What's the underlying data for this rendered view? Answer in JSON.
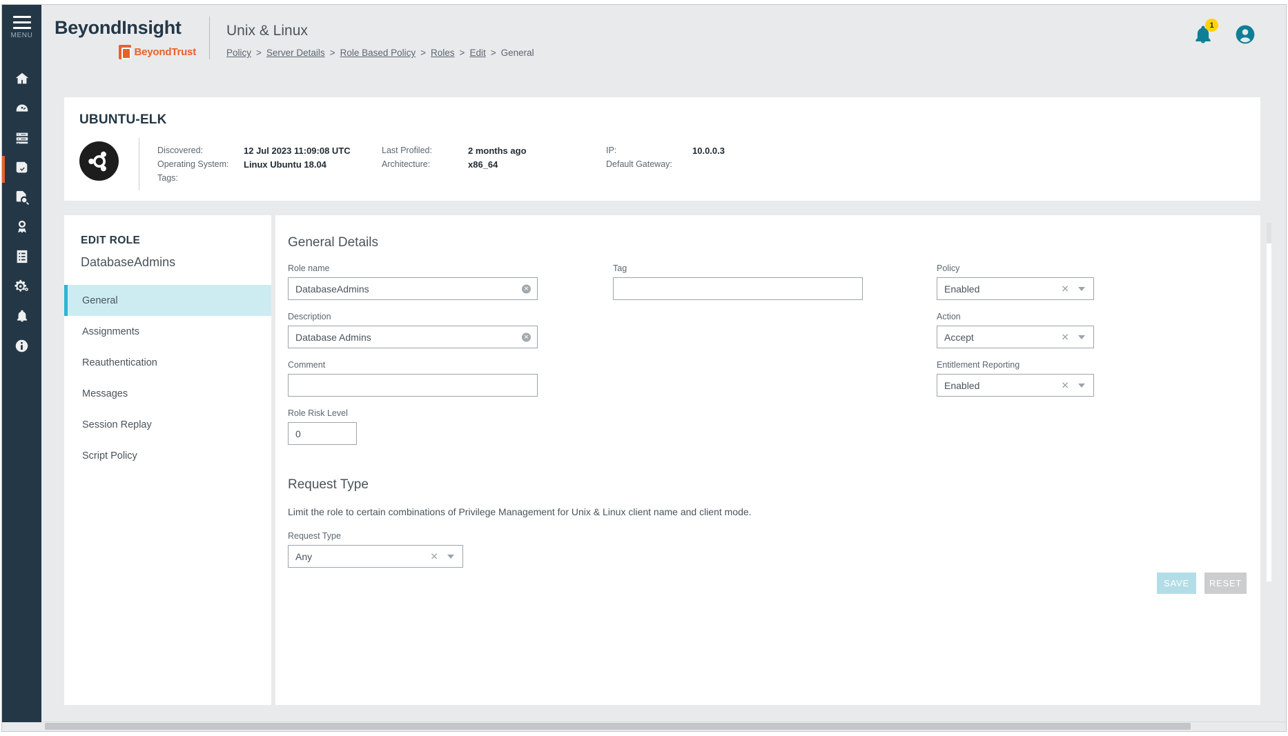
{
  "brand": {
    "product": "BeyondInsight",
    "company": "BeyondTrust",
    "logo_icon": "beyondtrust-logo-icon"
  },
  "header": {
    "page_title": "Unix & Linux",
    "breadcrumb": [
      {
        "label": "Policy",
        "link": true
      },
      {
        "label": "Server Details",
        "link": true
      },
      {
        "label": "Role Based Policy",
        "link": true
      },
      {
        "label": "Roles",
        "link": true
      },
      {
        "label": "Edit",
        "link": true
      },
      {
        "label": "General",
        "link": false
      }
    ],
    "separator": ">",
    "notifications": {
      "icon": "bell-icon",
      "count": "1"
    },
    "account": {
      "icon": "user-account-icon"
    }
  },
  "rail": {
    "menu_label": "MENU",
    "menu_icon": "hamburger-menu-icon",
    "items": [
      {
        "icon": "home-icon",
        "active": false
      },
      {
        "icon": "dashboard-gauge-icon",
        "active": false
      },
      {
        "icon": "server-stack-icon",
        "active": false
      },
      {
        "icon": "policy-document-icon",
        "active": true
      },
      {
        "icon": "file-search-icon",
        "active": false
      },
      {
        "icon": "award-badge-icon",
        "active": false
      },
      {
        "icon": "report-list-icon",
        "active": false
      },
      {
        "icon": "gears-configuration-icon",
        "active": false
      },
      {
        "icon": "bell-notification-icon",
        "active": false
      },
      {
        "icon": "info-circle-icon",
        "active": false
      }
    ]
  },
  "server_card": {
    "name": "UBUNTU-ELK",
    "os_logo_icon": "ubuntu-logo-icon",
    "details": [
      {
        "key": "Discovered:",
        "value": "12 Jul 2023 11:09:08 UTC"
      },
      {
        "key": "Last Profiled:",
        "value": "2 months ago"
      },
      {
        "key": "IP:",
        "value": "10.0.0.3"
      },
      {
        "key": "Operating System:",
        "value": "Linux Ubuntu 18.04"
      },
      {
        "key": "Architecture:",
        "value": "x86_64"
      },
      {
        "key": "Default Gateway:",
        "value": ""
      },
      {
        "key": "Tags:",
        "value": ""
      },
      {
        "key": "",
        "value": ""
      },
      {
        "key": "",
        "value": ""
      }
    ]
  },
  "edit_panel": {
    "kicker": "EDIT ROLE",
    "role_name": "DatabaseAdmins",
    "nav": [
      {
        "label": "General",
        "active": true
      },
      {
        "label": "Assignments",
        "active": false
      },
      {
        "label": "Reauthentication",
        "active": false
      },
      {
        "label": "Messages",
        "active": false
      },
      {
        "label": "Session Replay",
        "active": false
      },
      {
        "label": "Script Policy",
        "active": false
      }
    ]
  },
  "general_details": {
    "title": "General Details",
    "fields": {
      "role_name": {
        "label": "Role name",
        "value": "DatabaseAdmins",
        "placeholder": "",
        "clear_icon": "clear-circle-icon"
      },
      "description": {
        "label": "Description",
        "value": "Database Admins",
        "placeholder": "",
        "clear_icon": "clear-circle-icon"
      },
      "comment": {
        "label": "Comment",
        "value": "",
        "placeholder": ""
      },
      "risk_level": {
        "label": "Role Risk Level",
        "value": "0",
        "placeholder": ""
      },
      "tag": {
        "label": "Tag",
        "value": "",
        "placeholder": ""
      },
      "policy": {
        "label": "Policy",
        "value": "Enabled",
        "clear_icon": "clear-x-icon",
        "caret_icon": "chevron-down-icon"
      },
      "action": {
        "label": "Action",
        "value": "Accept",
        "clear_icon": "clear-x-icon",
        "caret_icon": "chevron-down-icon"
      },
      "entitlement": {
        "label": "Entitlement Reporting",
        "value": "Enabled",
        "clear_icon": "clear-x-icon",
        "caret_icon": "chevron-down-icon"
      }
    }
  },
  "request_type": {
    "title": "Request Type",
    "description": "Limit the role to certain combinations of Privilege Management for Unix & Linux client name and client mode.",
    "field": {
      "label": "Request Type",
      "value": "Any",
      "clear_icon": "clear-x-icon",
      "caret_icon": "chevron-down-icon"
    }
  },
  "actions": {
    "save_label": "SAVE",
    "reset_label": "RESET"
  },
  "colors": {
    "rail_bg": "#243746",
    "accent_orange": "#e8612c",
    "accent_teal": "#0f7f95",
    "nav_active_bg": "#cdecf2",
    "nav_active_bar": "#2ab6d1",
    "badge_yellow": "#ffd400",
    "save_disabled": "#b3dde6",
    "reset_disabled": "#cbcdcf"
  }
}
